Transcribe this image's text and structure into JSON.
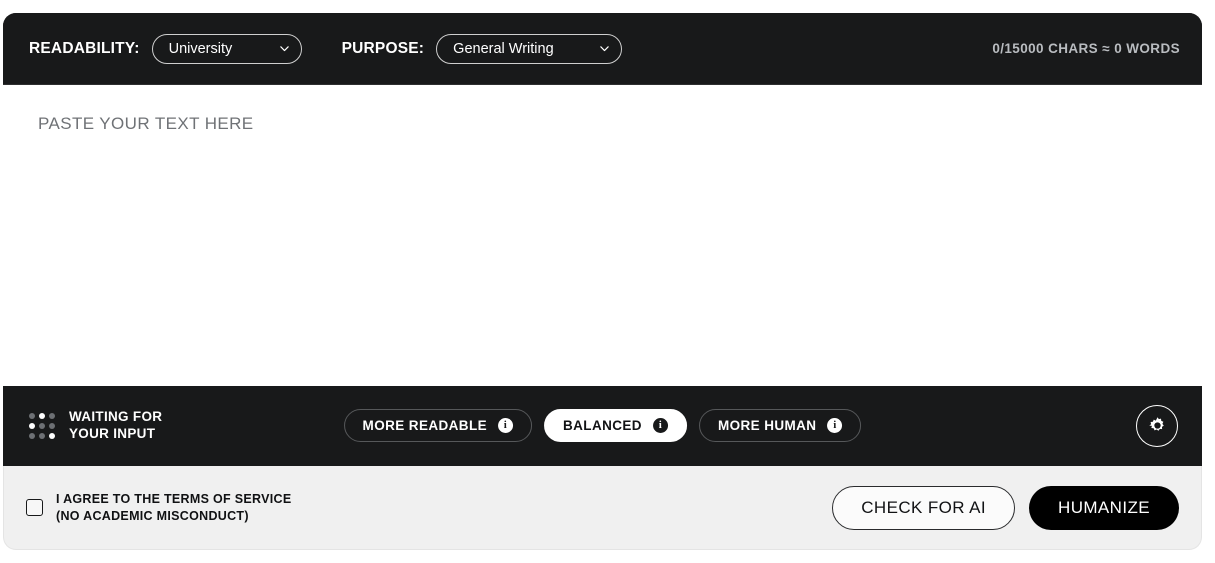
{
  "header": {
    "readability": {
      "label": "READABILITY:",
      "value": "University",
      "chevron_icon": "chevron-down-icon"
    },
    "purpose": {
      "label": "PURPOSE:",
      "value": "General Writing",
      "chevron_icon": "chevron-down-icon"
    },
    "char_counter": "0/15000 CHARS ≈ 0 WORDS"
  },
  "editor": {
    "placeholder": "PASTE YOUR TEXT HERE",
    "value": ""
  },
  "bottom_toolbar": {
    "status_icon": "dot-grid-icon",
    "status_line1": "WAITING FOR",
    "status_line2": "YOUR INPUT",
    "modes": [
      {
        "label": "MORE READABLE",
        "selected": false,
        "info_icon": "info-icon"
      },
      {
        "label": "BALANCED",
        "selected": true,
        "info_icon": "info-icon"
      },
      {
        "label": "MORE HUMAN",
        "selected": false,
        "info_icon": "info-icon"
      }
    ],
    "settings_icon": "gear-icon"
  },
  "footer": {
    "terms_checked": false,
    "terms_line1": "I AGREE TO THE TERMS OF SERVICE",
    "terms_line2": "(NO ACADEMIC MISCONDUCT)",
    "check_button": "CHECK FOR AI",
    "humanize_button": "HUMANIZE"
  },
  "colors": {
    "panel_dark": "#18191a",
    "page_bg": "#ffffff",
    "footer_bg": "#f0f0f0",
    "accent_white": "#ffffff",
    "counter_gray": "#b9bcc0"
  }
}
